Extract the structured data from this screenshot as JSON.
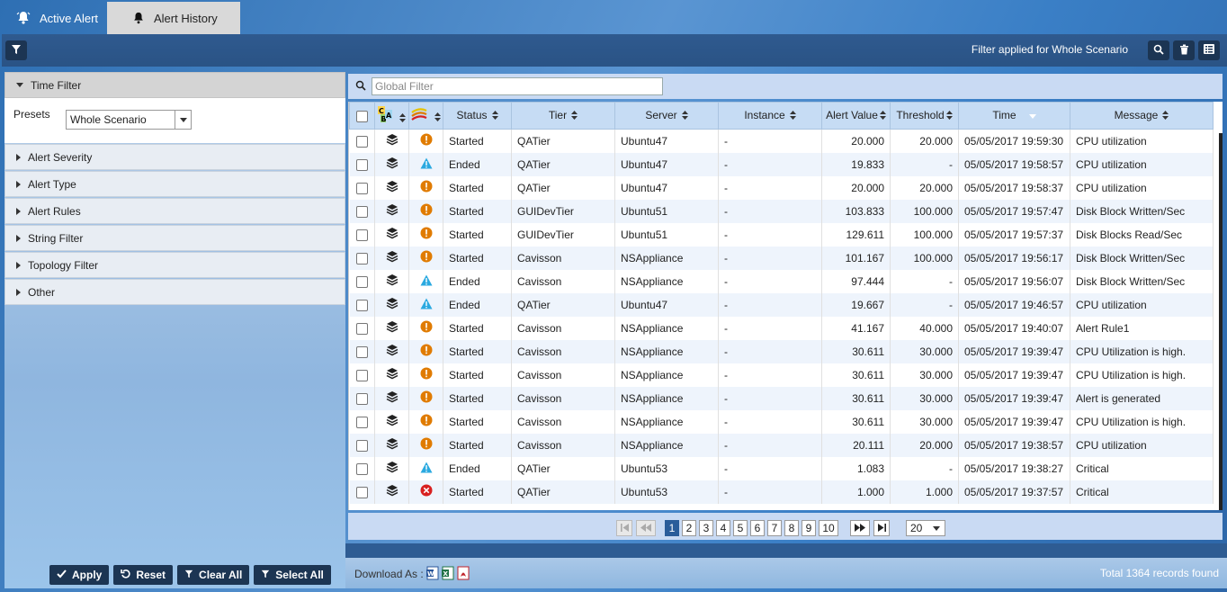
{
  "tabs": [
    {
      "label": "Active Alert",
      "active": true
    },
    {
      "label": "Alert History",
      "active": false
    }
  ],
  "toolbar": {
    "filter_applied_text": "Filter applied for Whole Scenario"
  },
  "left_panel": {
    "time_filter_label": "Time Filter",
    "presets_label": "Presets",
    "presets_value": "Whole Scenario",
    "sections": [
      "Alert Severity",
      "Alert Type",
      "Alert Rules",
      "String Filter",
      "Topology Filter",
      "Other"
    ],
    "buttons": {
      "apply": "Apply",
      "reset": "Reset",
      "clear_all": "Clear All",
      "select_all": "Select All"
    }
  },
  "global_filter": {
    "placeholder": "Global Filter"
  },
  "table": {
    "columns": [
      "Status",
      "Tier",
      "Server",
      "Instance",
      "Alert Value",
      "Threshold",
      "Time",
      "Message"
    ],
    "rows": [
      {
        "severity": "major",
        "status": "Started",
        "tier": "QATier",
        "server": "Ubuntu47",
        "instance": "-",
        "value": "20.000",
        "threshold": "20.000",
        "time": "05/05/2017 19:59:30",
        "message": "CPU utilization"
      },
      {
        "severity": "minor",
        "status": "Ended",
        "tier": "QATier",
        "server": "Ubuntu47",
        "instance": "-",
        "value": "19.833",
        "threshold": "-",
        "time": "05/05/2017 19:58:57",
        "message": "CPU utilization"
      },
      {
        "severity": "major",
        "status": "Started",
        "tier": "QATier",
        "server": "Ubuntu47",
        "instance": "-",
        "value": "20.000",
        "threshold": "20.000",
        "time": "05/05/2017 19:58:37",
        "message": "CPU utilization"
      },
      {
        "severity": "major",
        "status": "Started",
        "tier": "GUIDevTier",
        "server": "Ubuntu51",
        "instance": "-",
        "value": "103.833",
        "threshold": "100.000",
        "time": "05/05/2017 19:57:47",
        "message": "Disk Block Written/Sec"
      },
      {
        "severity": "major",
        "status": "Started",
        "tier": "GUIDevTier",
        "server": "Ubuntu51",
        "instance": "-",
        "value": "129.611",
        "threshold": "100.000",
        "time": "05/05/2017 19:57:37",
        "message": "Disk Blocks Read/Sec"
      },
      {
        "severity": "major",
        "status": "Started",
        "tier": "Cavisson",
        "server": "NSAppliance",
        "instance": "-",
        "value": "101.167",
        "threshold": "100.000",
        "time": "05/05/2017 19:56:17",
        "message": "Disk Block Written/Sec"
      },
      {
        "severity": "minor",
        "status": "Ended",
        "tier": "Cavisson",
        "server": "NSAppliance",
        "instance": "-",
        "value": "97.444",
        "threshold": "-",
        "time": "05/05/2017 19:56:07",
        "message": "Disk Block Written/Sec"
      },
      {
        "severity": "minor",
        "status": "Ended",
        "tier": "QATier",
        "server": "Ubuntu47",
        "instance": "-",
        "value": "19.667",
        "threshold": "-",
        "time": "05/05/2017 19:46:57",
        "message": "CPU utilization"
      },
      {
        "severity": "major",
        "status": "Started",
        "tier": "Cavisson",
        "server": "NSAppliance",
        "instance": "-",
        "value": "41.167",
        "threshold": "40.000",
        "time": "05/05/2017 19:40:07",
        "message": "Alert Rule1"
      },
      {
        "severity": "major",
        "status": "Started",
        "tier": "Cavisson",
        "server": "NSAppliance",
        "instance": "-",
        "value": "30.611",
        "threshold": "30.000",
        "time": "05/05/2017 19:39:47",
        "message": "CPU Utilization is high."
      },
      {
        "severity": "major",
        "status": "Started",
        "tier": "Cavisson",
        "server": "NSAppliance",
        "instance": "-",
        "value": "30.611",
        "threshold": "30.000",
        "time": "05/05/2017 19:39:47",
        "message": "CPU Utilization is high."
      },
      {
        "severity": "major",
        "status": "Started",
        "tier": "Cavisson",
        "server": "NSAppliance",
        "instance": "-",
        "value": "30.611",
        "threshold": "30.000",
        "time": "05/05/2017 19:39:47",
        "message": "Alert is generated"
      },
      {
        "severity": "major",
        "status": "Started",
        "tier": "Cavisson",
        "server": "NSAppliance",
        "instance": "-",
        "value": "30.611",
        "threshold": "30.000",
        "time": "05/05/2017 19:39:47",
        "message": "CPU Utilization is high."
      },
      {
        "severity": "major",
        "status": "Started",
        "tier": "Cavisson",
        "server": "NSAppliance",
        "instance": "-",
        "value": "20.111",
        "threshold": "20.000",
        "time": "05/05/2017 19:38:57",
        "message": "CPU utilization"
      },
      {
        "severity": "minor",
        "status": "Ended",
        "tier": "QATier",
        "server": "Ubuntu53",
        "instance": "-",
        "value": "1.083",
        "threshold": "-",
        "time": "05/05/2017 19:38:27",
        "message": "Critical"
      },
      {
        "severity": "critical",
        "status": "Started",
        "tier": "QATier",
        "server": "Ubuntu53",
        "instance": "-",
        "value": "1.000",
        "threshold": "1.000",
        "time": "05/05/2017 19:37:57",
        "message": "Critical"
      }
    ]
  },
  "pager": {
    "pages": [
      "1",
      "2",
      "3",
      "4",
      "5",
      "6",
      "7",
      "8",
      "9",
      "10"
    ],
    "current": "1",
    "page_size": "20"
  },
  "footer": {
    "download_label": "Download As :",
    "total_text": "Total 1364 records found"
  },
  "colors": {
    "major": "#e07b00",
    "minor": "#2aa9e0",
    "critical": "#d82020",
    "dark_button": "#1c3553"
  }
}
